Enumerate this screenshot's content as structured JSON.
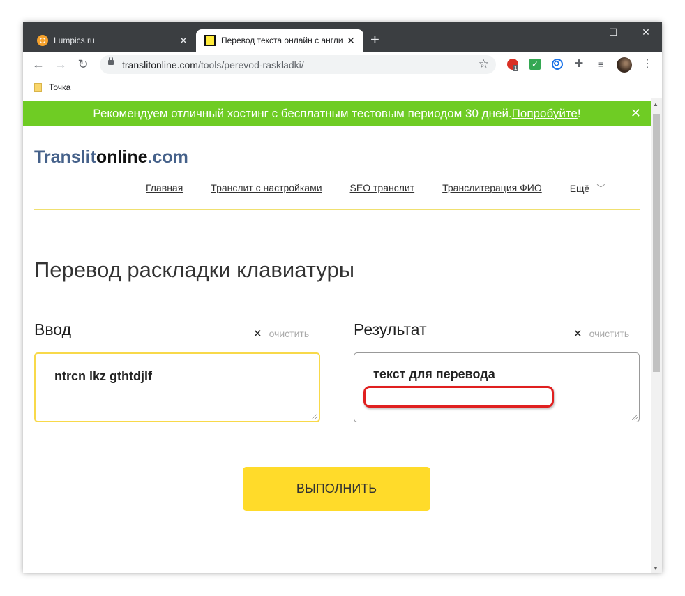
{
  "browser": {
    "tabs": [
      {
        "title": "Lumpics.ru",
        "active": false
      },
      {
        "title": "Перевод текста онлайн с англи",
        "active": true
      }
    ],
    "url_domain": "translitonline.com",
    "url_path": "/tools/perevod-raskladki/",
    "extension_badge": "1",
    "bookmarks": [
      {
        "label": "Точка"
      }
    ]
  },
  "banner": {
    "text": "Рекомендуем отличный хостинг с бесплатным тестовым периодом 30 дней. ",
    "link": "Попробуйте",
    "suffix": "!"
  },
  "site": {
    "logo_part1": "Translit",
    "logo_part2": "online",
    "logo_part3": ".com",
    "nav": [
      "Главная",
      "Транслит с настройками",
      "SEO транслит",
      "Транслитерация ФИО",
      "Ещё"
    ]
  },
  "main": {
    "heading": "Перевод раскладки клавиатуры",
    "input_label": "Ввод",
    "output_label": "Результат",
    "clear_label": "очистить",
    "input_value": "ntrcn lkz gthtdjlf",
    "output_value": "текст для перевода",
    "run_button": "ВЫПОЛНИТЬ"
  },
  "colors": {
    "banner": "#6fcc24",
    "button": "#ffdb2a",
    "logo_blue": "#45618a",
    "highlight": "#e02020"
  }
}
